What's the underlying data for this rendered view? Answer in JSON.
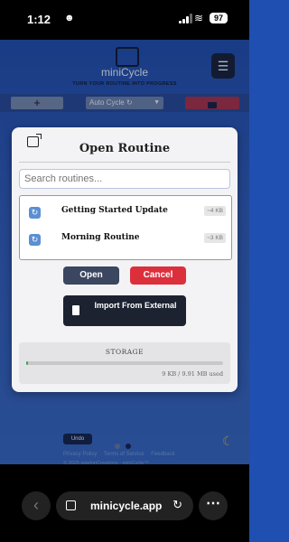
{
  "status_bar": {
    "time": "1:12",
    "battery": "97"
  },
  "app": {
    "title": "miniCycle",
    "tagline": "TURN YOUR ROUTINE INTO PROGRESS",
    "add_label": "+",
    "mode_select": "Auto Cycle ↻",
    "menu_icon": "hamburger-icon"
  },
  "modal": {
    "title": "Open Routine",
    "search_placeholder": "Search routines...",
    "routines": [
      {
        "name": "Getting Started Update",
        "size": "~4 KB"
      },
      {
        "name": "Morning Routine",
        "size": "~3 KB"
      }
    ],
    "open_label": "Open",
    "cancel_label": "Cancel",
    "import_label": "Import From External",
    "storage": {
      "title": "STORAGE",
      "usage": "9 KB / 9.91 MB used",
      "used_fraction": 0.001
    }
  },
  "footer": {
    "undo_label": "Undo",
    "links": [
      "Privacy Policy",
      "Terms of Service",
      "Feedback"
    ],
    "copyright": "© 2025 sparkinCreations · miniCycle™"
  },
  "browser": {
    "url": "minicycle.app"
  },
  "colors": {
    "app_bg": "#1f4fb0",
    "open_button": "#3b4660",
    "cancel_button": "#dc2f3c",
    "import_button": "#1c2230",
    "storage_fill": "#3aa65a"
  }
}
